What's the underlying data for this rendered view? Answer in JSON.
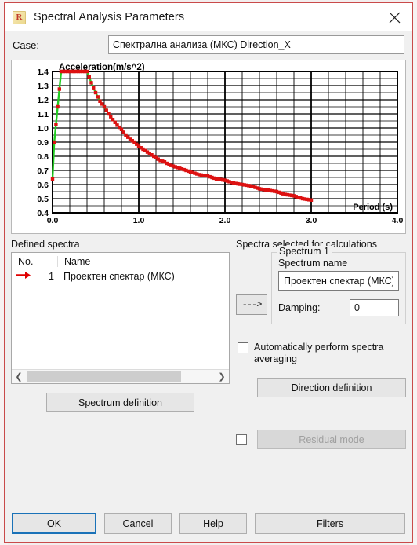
{
  "window": {
    "title": "Spectral Analysis Parameters",
    "app_icon": "robot-r-icon",
    "close_icon": "close-icon",
    "border_color": "#c94a4a"
  },
  "case": {
    "label": "Case:",
    "value": "Спектрална анализа (МКС) Direction_X",
    "placeholder": ""
  },
  "chart_data": {
    "type": "line",
    "title": "Acceleration(m/s^2)",
    "xlabel": "Period (s)",
    "ylabel": "Acceleration(m/s^2)",
    "xlim": [
      0.0,
      4.0
    ],
    "ylim": [
      0.4,
      1.4
    ],
    "xticks": [
      "0.0",
      "1.0",
      "2.0",
      "3.0",
      "4.0"
    ],
    "yticks": [
      "0.4",
      "0.5",
      "0.6",
      "0.7",
      "0.8",
      "0.9",
      "1.0",
      "1.1",
      "1.2",
      "1.3",
      "1.4"
    ],
    "grid": true,
    "legend": "none",
    "line_color": "#22cc22",
    "marker_color": "#dd1111",
    "marker": "square",
    "series": [
      {
        "name": "Проектен спектар (МКС)",
        "x": [
          0.0,
          0.02,
          0.06,
          0.1,
          0.15,
          0.2,
          0.25,
          0.3,
          0.35,
          0.4,
          0.45,
          0.5,
          0.55,
          0.6,
          0.65,
          0.7,
          0.75,
          0.8,
          0.85,
          0.9,
          0.95,
          1.0,
          1.05,
          1.1,
          1.15,
          1.2,
          1.25,
          1.3,
          1.35,
          1.4,
          1.45,
          1.5,
          1.6,
          1.7,
          1.8,
          1.9,
          2.0,
          2.1,
          2.2,
          2.3,
          2.4,
          2.5,
          2.6,
          2.7,
          2.8,
          2.9,
          3.0
        ],
        "y": [
          0.64,
          0.9,
          1.15,
          1.4,
          1.4,
          1.4,
          1.4,
          1.4,
          1.4,
          1.4,
          1.32,
          1.25,
          1.19,
          1.15,
          1.1,
          1.06,
          1.02,
          0.99,
          0.95,
          0.92,
          0.9,
          0.87,
          0.85,
          0.83,
          0.81,
          0.79,
          0.77,
          0.76,
          0.74,
          0.73,
          0.72,
          0.71,
          0.69,
          0.67,
          0.66,
          0.64,
          0.63,
          0.61,
          0.6,
          0.59,
          0.57,
          0.56,
          0.55,
          0.53,
          0.52,
          0.5,
          0.49
        ]
      }
    ]
  },
  "defined_spectra": {
    "group_label": "Defined spectra",
    "columns": [
      "No.",
      "Name"
    ],
    "rows": [
      {
        "marker": "selected-arrow-icon",
        "no": "1",
        "name": "Проектен спектар (МКС)"
      }
    ],
    "scroll_left_icon": "chevron-left-icon",
    "scroll_right_icon": "chevron-right-icon",
    "spectrum_definition_button": "Spectrum definition"
  },
  "selected_spectra": {
    "group_label": "Spectra selected for calculations",
    "fieldset_legend": "Spectrum 1",
    "transfer_button": "--->",
    "spectrum_name_label": "Spectrum name",
    "spectrum_name_value": "Проектен спектар (МКС)",
    "damping_label": "Damping:",
    "damping_value": "0"
  },
  "options": {
    "auto_averaging_label": "Automatically perform spectra averaging",
    "auto_averaging_checked": false,
    "direction_definition_button": "Direction definition",
    "residual_mode_label": "Residual mode",
    "residual_mode_checked": false,
    "residual_mode_disabled": true
  },
  "footer": {
    "ok": "OK",
    "cancel": "Cancel",
    "help": "Help",
    "filters": "Filters",
    "focus_color": "#1a72b8"
  }
}
